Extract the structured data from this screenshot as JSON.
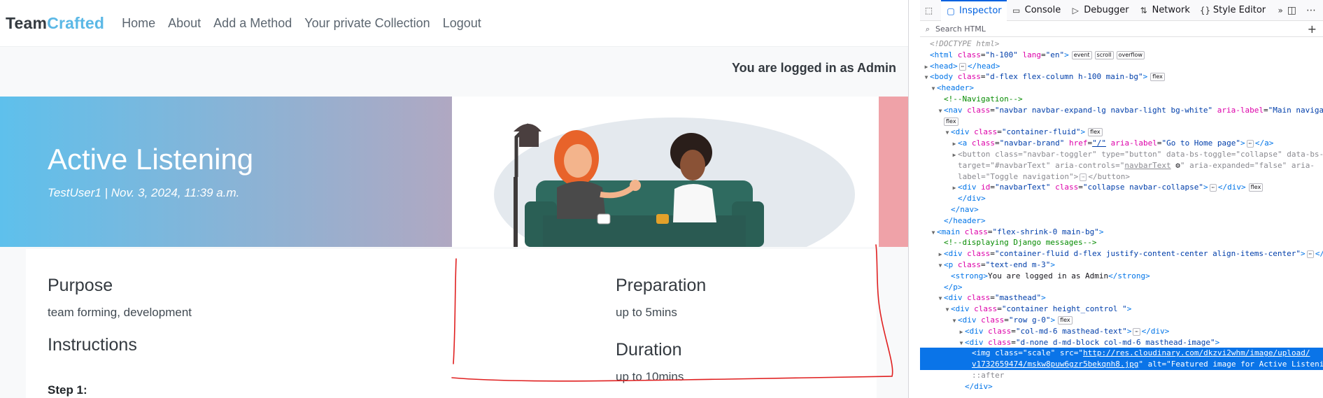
{
  "navbar": {
    "brand_part1": "Team",
    "brand_part2": "Crafted",
    "links": [
      "Home",
      "About",
      "Add a Method",
      "Your private Collection",
      "Logout"
    ]
  },
  "message": "You are logged in as Admin",
  "masthead": {
    "title": "Active Listening",
    "meta": "TestUser1 | Nov. 3, 2024, 11:39 a.m."
  },
  "details": {
    "purpose_heading": "Purpose",
    "purpose_text": "team forming, development",
    "instructions_heading": "Instructions",
    "step_label": "Step 1:",
    "preparation_heading": "Preparation",
    "preparation_text": "up to 5mins",
    "duration_heading": "Duration",
    "duration_text": "up to 10mins"
  },
  "devtools": {
    "tabs": [
      "Inspector",
      "Console",
      "Debugger",
      "Network",
      "Style Editor"
    ],
    "search_placeholder": "Search HTML",
    "tree": {
      "l1": "<!DOCTYPE html>",
      "l2_tag": "<html",
      "l2_a1": "class",
      "l2_v1": "\"h-100\"",
      "l2_a2": "lang",
      "l2_v2": "\"en\"",
      "l2_end": ">",
      "l2_b1": "event",
      "l2_b2": "scroll",
      "l2_b3": "overflow",
      "l3_open": "<head>",
      "l3_close": "</head>",
      "l4_tag": "<body",
      "l4_a1": "class",
      "l4_v1": "\"d-flex flex-column h-100 main-bg\"",
      "l4_end": ">",
      "badge_flex": "flex",
      "l5": "<header>",
      "l6": "<!--Navigation-->",
      "l7_tag": "<nav",
      "l7_a1": "class",
      "l7_v1": "\"navbar navbar-expand-lg navbar-light bg-white\"",
      "l7_a2": "aria-label",
      "l7_v2": "\"Main navigation\"",
      "l7_end": ">",
      "l9_tag": "<div",
      "l9_a1": "class",
      "l9_v1": "\"container-fluid\"",
      "l9_end": ">",
      "l10_tag": "<a",
      "l10_a1": "class",
      "l10_v1": "\"navbar-brand\"",
      "l10_a2": "href",
      "l10_v2": "\"/\"",
      "l10_a3": "aria-label",
      "l10_v3": "\"Go to Home page\"",
      "l10_close": "</a>",
      "l11": "<button class=\"navbar-toggler\" type=\"button\" data-bs-toggle=\"collapse\" data-bs-",
      "l12a": "target=\"#navbarText\" aria-controls=\"",
      "l12b": "navbarText",
      "l12c": "\" aria-expanded=\"false\" aria-",
      "l13a": "label=\"Toggle navigation\">",
      "l13b": "</button>",
      "l14_tag": "<div",
      "l14_a1": "id",
      "l14_v1": "\"navbarText\"",
      "l14_a2": "class",
      "l14_v2": "\"collapse navbar-collapse\"",
      "l14_end": ">",
      "l14_close": "</div>",
      "l15": "</div>",
      "l16": "</nav>",
      "l17": "</header>",
      "l18_tag": "<main",
      "l18_a1": "class",
      "l18_v1": "\"flex-shrink-0 main-bg\"",
      "l18_end": ">",
      "l19": "<!--displaying Django messages-->",
      "l20_tag": "<div",
      "l20_a1": "class",
      "l20_v1": "\"container-fluid d-flex justify-content-center align-items-center\"",
      "l20_end": ">",
      "l20_close": "</div>",
      "l21_tag": "<p",
      "l21_a1": "class",
      "l21_v1": "\"text-end m-3\"",
      "l21_end": ">",
      "l22_open": "<strong>",
      "l22_text": "You are logged in as Admin",
      "l22_close": "</strong>",
      "l23": "</p>",
      "l24_tag": "<div",
      "l24_a1": "class",
      "l24_v1": "\"masthead\"",
      "l24_end": ">",
      "l25_tag": "<div",
      "l25_a1": "class",
      "l25_v1": "\"container height_control \"",
      "l25_end": ">",
      "l26_tag": "<div",
      "l26_a1": "class",
      "l26_v1": "\"row g-0\"",
      "l26_end": ">",
      "l27_tag": "<div",
      "l27_a1": "class",
      "l27_v1": "\"col-md-6 masthead-text\"",
      "l27_end": ">",
      "l27_close": "</div>",
      "l28_tag": "<div",
      "l28_a1": "class",
      "l28_v1": "\"d-none d-md-block col-md-6 masthead-image\"",
      "l28_end": ">",
      "l29a": "<img class=\"scale\" src=\"",
      "l29b": "http://res.cloudinary.com/dkzvi2whm/image/upload/",
      "l30a": "v1732659474/mskw8puw6gzr5bekqnh8.jpg",
      "l30b": "\" alt=\"Featured image for Active Listening\">",
      "l31": "::after",
      "l32": "</div>"
    }
  },
  "colors": {
    "brand_accent": "#5bb8e6",
    "selection": "#0a74e8",
    "annotation": "#e02020"
  }
}
